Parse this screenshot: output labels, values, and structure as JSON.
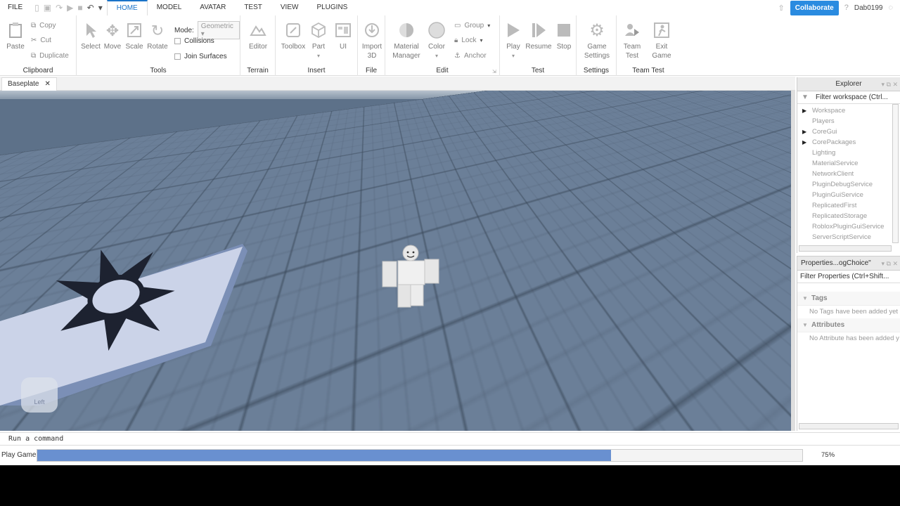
{
  "menubar": {
    "file": "FILE",
    "tabs": [
      {
        "label": "HOME"
      },
      {
        "label": "MODEL"
      },
      {
        "label": "AVATAR"
      },
      {
        "label": "TEST"
      },
      {
        "label": "VIEW"
      },
      {
        "label": "PLUGINS"
      }
    ],
    "collaborate": "Collaborate",
    "username": "Dab0199"
  },
  "ribbon": {
    "clipboard": {
      "label": "Clipboard",
      "paste": "Paste",
      "copy": "Copy",
      "cut": "Cut",
      "duplicate": "Duplicate"
    },
    "tools": {
      "label": "Tools",
      "select": "Select",
      "move": "Move",
      "scale": "Scale",
      "rotate": "Rotate",
      "mode_label": "Mode:",
      "mode_value": "Geometric",
      "collisions": "Collisions",
      "join_surfaces": "Join Surfaces"
    },
    "terrain": {
      "label": "Terrain",
      "editor": "Editor"
    },
    "insert": {
      "label": "Insert",
      "toolbox": "Toolbox",
      "part": "Part",
      "ui": "UI"
    },
    "file": {
      "label": "File",
      "import_line1": "Import",
      "import_line2": "3D"
    },
    "edit": {
      "label": "Edit",
      "material_line1": "Material",
      "material_line2": "Manager",
      "color": "Color",
      "group": "Group",
      "lock": "Lock",
      "anchor": "Anchor"
    },
    "test": {
      "label": "Test",
      "play": "Play",
      "resume": "Resume",
      "stop": "Stop"
    },
    "settings": {
      "label": "Settings",
      "game_line1": "Game",
      "game_line2": "Settings"
    },
    "team_test": {
      "label": "Team Test",
      "team_line1": "Team",
      "team_line2": "Test",
      "exit_line1": "Exit",
      "exit_line2": "Game"
    }
  },
  "document_tab": {
    "label": "Baseplate",
    "close": "✕"
  },
  "viewport": {
    "view_cube_label": "Left"
  },
  "explorer": {
    "title": "Explorer",
    "filter": "Filter workspace (Ctrl...",
    "items": [
      {
        "label": "Workspace",
        "expandable": true
      },
      {
        "label": "Players",
        "expandable": false
      },
      {
        "label": "CoreGui",
        "expandable": true
      },
      {
        "label": "CorePackages",
        "expandable": true
      },
      {
        "label": "Lighting",
        "expandable": false
      },
      {
        "label": "MaterialService",
        "expandable": false
      },
      {
        "label": "NetworkClient",
        "expandable": false
      },
      {
        "label": "PluginDebugService",
        "expandable": false
      },
      {
        "label": "PluginGuiService",
        "expandable": false
      },
      {
        "label": "ReplicatedFirst",
        "expandable": false
      },
      {
        "label": "ReplicatedStorage",
        "expandable": false
      },
      {
        "label": "RobloxPluginGuiService",
        "expandable": false
      },
      {
        "label": "ServerScriptService",
        "expandable": false
      }
    ]
  },
  "properties": {
    "title": "Properties...ogChoice\"",
    "filter": "Filter Properties (Ctrl+Shift...",
    "tags_label": "Tags",
    "tags_note": "No Tags have been added yet",
    "attributes_label": "Attributes",
    "attributes_note": "No Attribute has been added y"
  },
  "command_bar": {
    "placeholder": "Run a command"
  },
  "status": {
    "label": "Play Game",
    "progress": 0.75,
    "progress_text": "75%"
  },
  "colors": {
    "accent": "#2a8be0",
    "progress": "#6990d0"
  }
}
